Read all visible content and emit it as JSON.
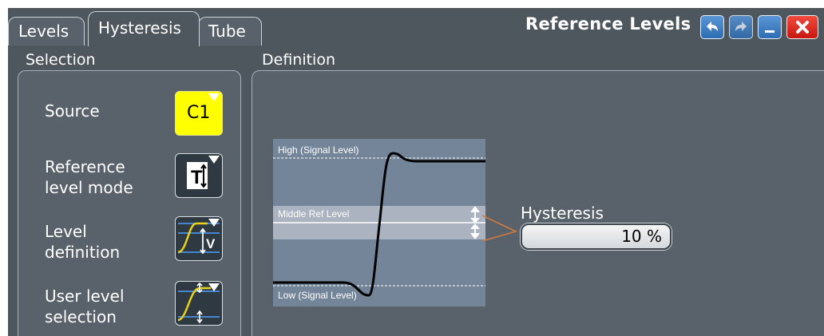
{
  "tabs": [
    {
      "label": "Levels"
    },
    {
      "label": "Hysteresis"
    },
    {
      "label": "Tube"
    }
  ],
  "dialog": {
    "title": "Reference Levels"
  },
  "window_buttons": [
    "undo-icon",
    "redo-icon",
    "minimize-icon",
    "close-icon"
  ],
  "selection": {
    "heading": "Selection",
    "rows": [
      {
        "label": "Source",
        "value": "C1"
      },
      {
        "label": "Reference\nlevel mode",
        "icon": "T-arrow-icon"
      },
      {
        "label": "Level\ndefinition",
        "icon": "level-definition-icon"
      },
      {
        "label": "User level\nselection",
        "icon": "user-level-icon"
      }
    ]
  },
  "definition": {
    "heading": "Definition",
    "diagram": {
      "high_label": "High (Signal Level)",
      "middle_label": "Middle Ref Level",
      "low_label": "Low (Signal Level)"
    },
    "hysteresis_label": "Hysteresis",
    "hysteresis_value": "10 %"
  },
  "colors": {
    "source_yellow": "#ffff00",
    "background": "#4e565e",
    "panel": "#59626b",
    "diagram_bg": "#758599"
  }
}
